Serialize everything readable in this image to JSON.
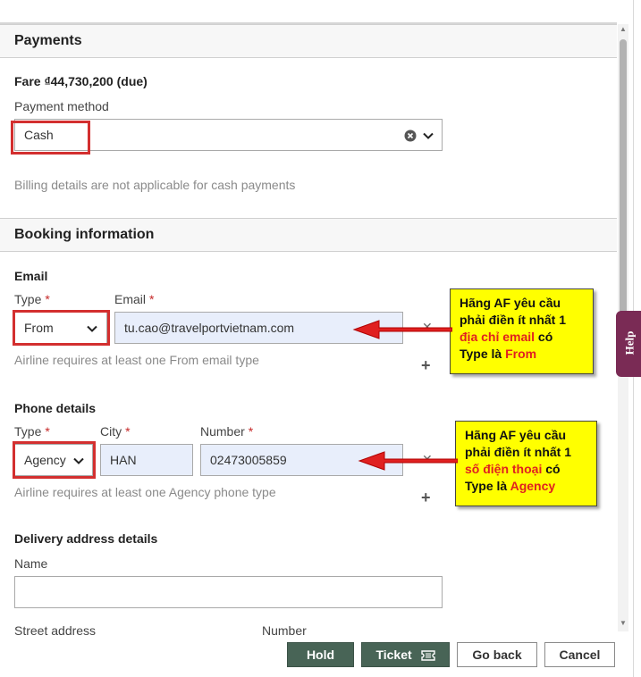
{
  "payments": {
    "title": "Payments",
    "fare": "Fare ₫44,730,200 (due)",
    "method_label": "Payment method",
    "method_value": "Cash",
    "billing_note": "Billing details are not applicable for cash payments"
  },
  "booking": {
    "title": "Booking information",
    "email": {
      "heading": "Email",
      "type_label": "Type",
      "email_label": "Email",
      "required_mark": "*",
      "type_value": "From",
      "email_value": "tu.cao@travelportvietnam.com",
      "hint": "Airline requires at least one From email type"
    },
    "phone": {
      "heading": "Phone details",
      "type_label": "Type",
      "city_label": "City",
      "number_label": "Number",
      "type_value": "Agency",
      "city_value": "HAN",
      "number_value": "02473005859",
      "hint": "Airline requires at least one Agency phone type"
    },
    "delivery": {
      "heading": "Delivery address details",
      "name_label": "Name",
      "name_value": "",
      "street_label": "Street address",
      "number_label": "Number"
    }
  },
  "callouts": {
    "email": {
      "line1": "Hãng AF yêu cầu",
      "line2": "phải điền ít nhất 1",
      "red1": "địa chỉ email",
      "after1": " có",
      "line4a": "Type là ",
      "red2": "From"
    },
    "phone": {
      "line1": "Hãng AF yêu cầu",
      "line2": "phải điền ít nhất 1",
      "red1": "số điện thoại",
      "after1": " có",
      "line4a": "Type là ",
      "red2": "Agency"
    }
  },
  "help": {
    "label": "Help"
  },
  "actions": {
    "hold": "Hold",
    "ticket": "Ticket",
    "go_back": "Go back",
    "cancel": "Cancel"
  },
  "colors": {
    "primary_button": "#486456",
    "annotation_red": "#d32f2f",
    "callout_bg": "#ffff00",
    "help_tab": "#7a2b55",
    "filled_input": "#e8eefb"
  },
  "icons": {
    "clear": "clear-icon",
    "chevron": "chevron-down-icon",
    "remove": "close-icon",
    "add": "plus-icon",
    "ticket": "ticket-icon"
  }
}
